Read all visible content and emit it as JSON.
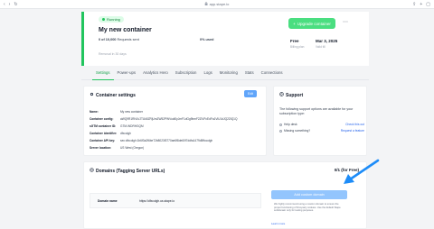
{
  "browser": {
    "url": "app.stape.io",
    "nav_back": "‹",
    "nav_forward": "›",
    "reload": "↻"
  },
  "header": {
    "status_badge": "Running",
    "title": "My new container",
    "usage_count": "0 of 10,000",
    "usage_label": "Requests sent",
    "usage_pct": "0% used",
    "plan": "Free",
    "plan_label": "Billing plan",
    "date": "Mar 3, 2025",
    "date_label": "Valid till",
    "upgrade_label": "Upgrade container",
    "more_label": "⋯",
    "removal_note": "Removal in 30 days"
  },
  "tabs": [
    "Settings",
    "Power-ups",
    "Analytics Hero",
    "Subscription",
    "Logs",
    "Monitoring",
    "Stats",
    "Connections"
  ],
  "settings": {
    "title": "Container settings",
    "edit_label": "Edit",
    "rows": [
      {
        "key": "Name:",
        "value": "My new container"
      },
      {
        "key": "Container config:",
        "value": "aWQ9R1RNLVJTUk5ZRjUmZW52PWVudi0yJmF1dGg9bmF2ZlVFcEdFa1ViU1dJQ2ZtQ1Q"
      },
      {
        "key": "sGTM container ID:",
        "value": "GTM-WDRHGQM"
      },
      {
        "key": "Container identifier:",
        "value": "dfxcolgh"
      },
      {
        "key": "Container API key:",
        "value": "sec:dfxcolgh:1b6f3a2f6be72b8023f3770ae6f8de60f7ddfa1479d5ffccolgh"
      },
      {
        "key": "Server location:",
        "value": "US West (Oregon)"
      }
    ]
  },
  "support": {
    "title": "Support",
    "description": "The following support options are available for your subscription type:",
    "options": [
      {
        "label": "Help desk",
        "link": "Check this out"
      },
      {
        "label": "Missing something?",
        "link": "Request a feature"
      }
    ]
  },
  "domains": {
    "title": "Domains (Tagging Server URLs)",
    "quota": "0/1 (for Free)",
    "row_key": "Domain name",
    "row_value": "https://dfxcolgh.us.stape.io",
    "add_label": "Add custom domain",
    "note": "We highly recommend using a custom domain to ensure the proper functioning of first-party cookies. Use the default Stape subdomain only for testing purposes.",
    "learn_more": "Learn more"
  },
  "colors": {
    "accent_green": "#22c55e",
    "blue_button": "#60a5fa",
    "annotation_arrow": "#1d8cf8"
  }
}
